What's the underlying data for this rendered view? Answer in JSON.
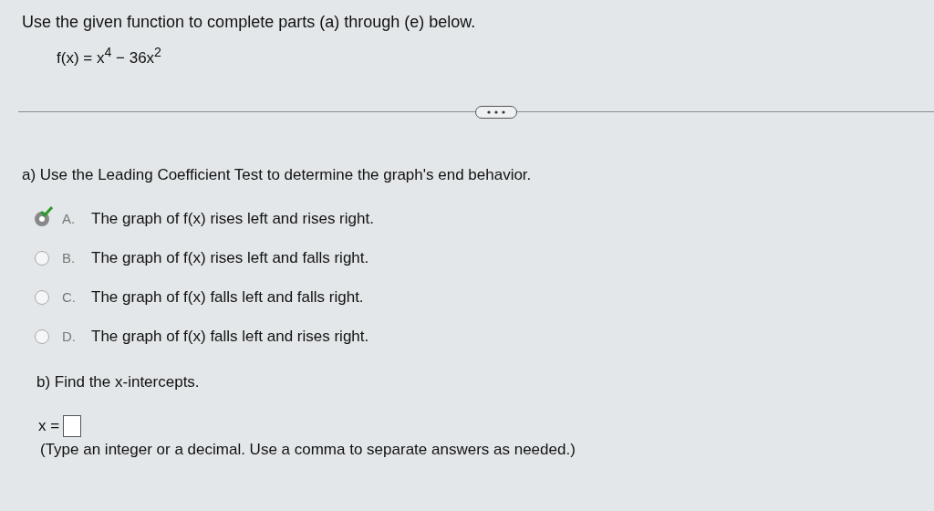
{
  "instructions": "Use the given function to complete parts (a) through (e) below.",
  "function": "f(x) = x$^{4}$ − 36x$^{2}$",
  "part_a": {
    "prompt": "a) Use the Leading Coefficient Test to determine the graph's end behavior.",
    "choices": [
      {
        "letter": "A.",
        "text": "The graph of f(x) rises left and rises right.",
        "selected": true,
        "correct": true
      },
      {
        "letter": "B.",
        "text": "The graph of f(x) rises left and falls right.",
        "selected": false,
        "correct": false
      },
      {
        "letter": "C.",
        "text": "The graph of f(x) falls left and falls right.",
        "selected": false,
        "correct": false
      },
      {
        "letter": "D.",
        "text": "The graph of f(x) falls left and rises right.",
        "selected": false,
        "correct": false
      }
    ]
  },
  "part_b": {
    "prompt": "b) Find the x-intercepts.",
    "answer_label": "x =",
    "hint": "(Type an integer or a decimal. Use a comma to separate answers as needed.)"
  }
}
